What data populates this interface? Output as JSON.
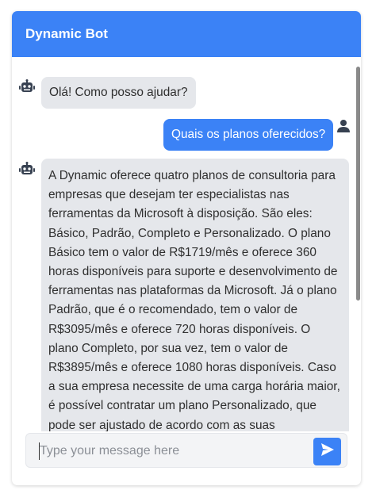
{
  "header": {
    "title": "Dynamic Bot"
  },
  "messages": [
    {
      "sender": "bot",
      "text": "Olá! Como posso ajudar?"
    },
    {
      "sender": "user",
      "text": "Quais os planos oferecidos?"
    },
    {
      "sender": "bot",
      "text": "A Dynamic oferece quatro planos de consultoria para empresas que desejam ter especialistas nas ferramentas da Microsoft à disposição. São eles: Básico, Padrão, Completo e Personalizado. O plano Básico tem o valor de R$1719/mês e oferece 360 horas disponíveis para suporte e desenvolvimento de ferramentas nas plataformas da Microsoft. Já o plano Padrão, que é o recomendado, tem o valor de R$3095/mês e oferece 720 horas disponíveis. O plano Completo, por sua vez, tem o valor de R$3895/mês e oferece 1080 horas disponíveis. Caso a sua empresa necessite de uma carga horária maior, é possível contratar um plano Personalizado, que pode ser ajustado de acordo com as suas"
    }
  ],
  "composer": {
    "placeholder": "Type your message here",
    "value": ""
  },
  "colors": {
    "accent": "#3b82f6",
    "bot_bubble": "#e5e7eb",
    "icon": "#374151"
  },
  "icons": {
    "bot": "robot-icon",
    "user": "person-icon",
    "send": "send-icon"
  }
}
